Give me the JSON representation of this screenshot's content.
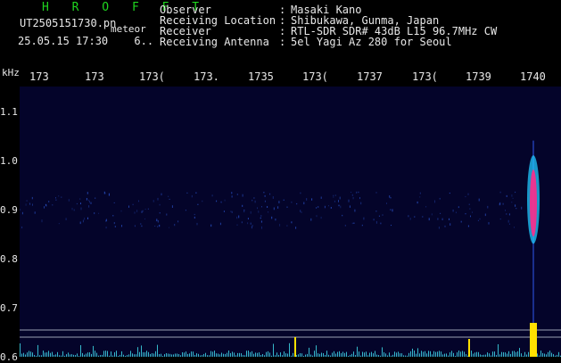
{
  "header": {
    "app_logo_text": "H R O F F T",
    "filename": "UT2505151730.pn",
    "file_type": "meteor",
    "datetime": "25.05.15 17:30",
    "datetime_suffix": "6.."
  },
  "info": [
    {
      "label": "Observer",
      "value": "Masaki Kano"
    },
    {
      "label": "Receiving Location",
      "value": "Shibukawa, Gunma, Japan"
    },
    {
      "label": "Receiver",
      "value": "RTL-SDR SDR# 43dB L15 96.7MHz CW"
    },
    {
      "label": "Receiving Antenna",
      "value": "5el Yagi Az 280 for Seoul"
    }
  ],
  "chart_data": {
    "type": "heatmap",
    "ylabel": "kHz",
    "x_tick_labels": [
      "173",
      "173",
      "173(",
      "173.",
      "1735",
      "173(",
      "1737",
      "173(",
      "1739",
      "1740"
    ],
    "y_tick_labels": [
      "1.1",
      "1.0",
      "0.9",
      "0.8",
      "0.7",
      "0.6"
    ],
    "ylim": [
      0.6,
      1.15
    ],
    "colors": {
      "background": "#04042a",
      "noise_band": "#2a52c8",
      "meteor_core": "#ff2a8a",
      "meteor_edge": "#20c8ff",
      "level_trace": "#40d8e8",
      "level_spike": "#ffe000"
    },
    "events": [
      {
        "label": "meteor",
        "x_time": "1740",
        "y_khz_range": [
          0.83,
          1.01
        ],
        "intensity": "strong"
      }
    ],
    "noise_band_khz": 0.9
  }
}
